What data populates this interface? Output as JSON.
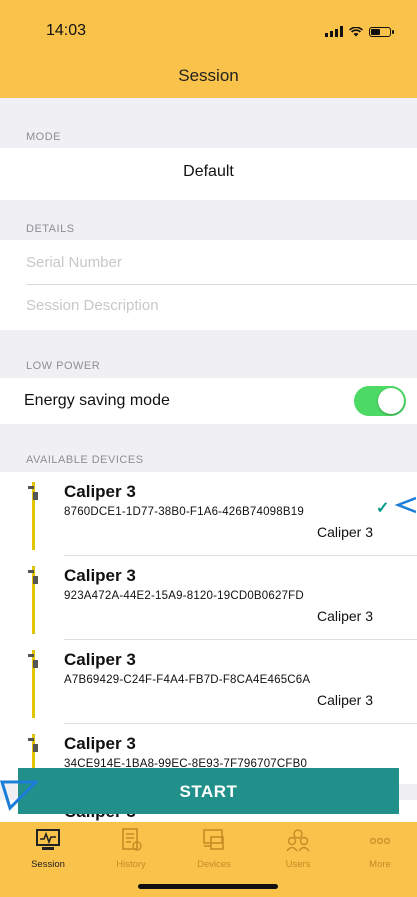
{
  "status_bar": {
    "time": "14:03"
  },
  "nav": {
    "title": "Session"
  },
  "sections": {
    "mode": "MODE",
    "details": "DETAILS",
    "low_power": "LOW POWER",
    "devices": "AVAILABLE DEVICES"
  },
  "mode": {
    "value": "Default"
  },
  "details": {
    "serial_placeholder": "Serial Number",
    "description_placeholder": "Session Description"
  },
  "low_power": {
    "label": "Energy saving mode",
    "enabled": true
  },
  "devices": [
    {
      "name": "Caliper 3",
      "id": "8760DCE1-1D77-38B0-F1A6-426B74098B19",
      "type": "Caliper 3",
      "selected": true
    },
    {
      "name": "Caliper 3",
      "id": "923A472A-44E2-15A9-8120-19CD0B0627FD",
      "type": "Caliper 3",
      "selected": false
    },
    {
      "name": "Caliper 3",
      "id": "A7B69429-C24F-F4A4-FB7D-F8CA4E465C6A",
      "type": "Caliper 3",
      "selected": false
    },
    {
      "name": "Caliper 3",
      "id": "34CE914E-1BA8-99EC-8E93-7F796707CFB0",
      "type": "",
      "selected": false
    },
    {
      "name": "Caliper 3",
      "id": "",
      "type": "",
      "selected": false
    }
  ],
  "start_button": {
    "label": "START"
  },
  "tabs": [
    {
      "label": "Session",
      "icon": "session-icon",
      "active": true
    },
    {
      "label": "History",
      "icon": "history-icon",
      "active": false
    },
    {
      "label": "Devices",
      "icon": "devices-icon",
      "active": false
    },
    {
      "label": "Users",
      "icon": "users-icon",
      "active": false
    },
    {
      "label": "More",
      "icon": "more-icon",
      "active": false
    }
  ],
  "colors": {
    "header": "#f9c24b",
    "accent": "#21908a",
    "toggle_on": "#4cd964",
    "tab_inactive": "#c98a24"
  }
}
